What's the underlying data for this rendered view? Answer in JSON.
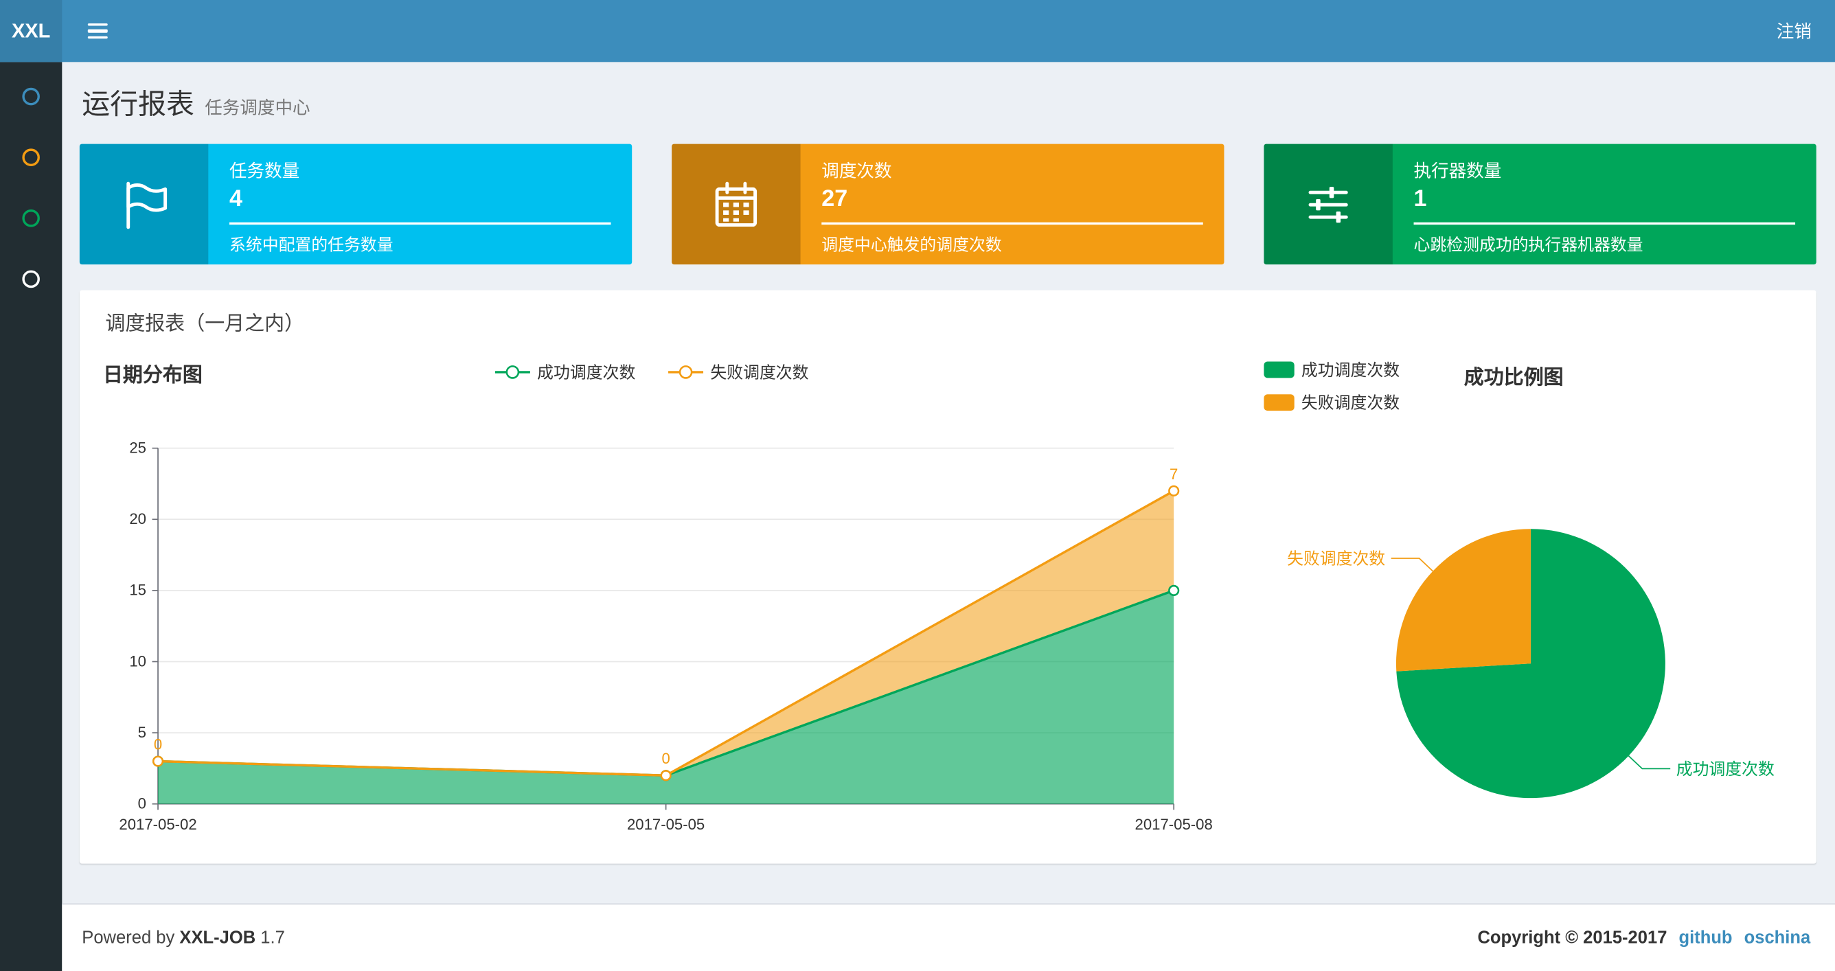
{
  "navbar": {
    "logo": "XXL",
    "logout_label": "注销"
  },
  "sidebar": {
    "items": [
      {
        "icon": "circle-o-icon",
        "color": "#3c8dbc"
      },
      {
        "icon": "circle-o-icon",
        "color": "#f39c12"
      },
      {
        "icon": "circle-o-icon",
        "color": "#00a65a"
      },
      {
        "icon": "circle-o-icon",
        "color": "#ffffff"
      }
    ]
  },
  "header": {
    "title": "运行报表",
    "subtitle": "任务调度中心"
  },
  "info_boxes": [
    {
      "title": "任务数量",
      "value": "4",
      "desc": "系统中配置的任务数量",
      "color": "#00c0ef",
      "icon": "flag-icon"
    },
    {
      "title": "调度次数",
      "value": "27",
      "desc": "调度中心触发的调度次数",
      "color": "#f39c12",
      "icon": "calendar-icon"
    },
    {
      "title": "执行器数量",
      "value": "1",
      "desc": "心跳检测成功的执行器机器数量",
      "color": "#00a65a",
      "icon": "sliders-icon"
    }
  ],
  "panel": {
    "title": "调度报表（一月之内）"
  },
  "chart_data": [
    {
      "type": "area",
      "title": "日期分布图",
      "stacked": true,
      "categories": [
        "2017-05-02",
        "2017-05-05",
        "2017-05-08"
      ],
      "series": [
        {
          "name": "成功调度次数",
          "values": [
            3,
            2,
            15
          ],
          "color": "#00a65a",
          "fill": "rgba(0,166,90,0.62)"
        },
        {
          "name": "失败调度次数",
          "values": [
            0,
            0,
            7
          ],
          "color": "#f39c12",
          "fill": "rgba(243,156,18,0.55)",
          "labels": [
            "0",
            "0",
            "7"
          ]
        }
      ],
      "ylim": [
        0,
        25
      ],
      "yticks": [
        0,
        5,
        10,
        15,
        20,
        25
      ],
      "legend_position": "top",
      "grid": true
    },
    {
      "type": "pie",
      "title": "成功比例图",
      "slices": [
        {
          "name": "成功调度次数",
          "value": 20,
          "color": "#00a65a"
        },
        {
          "name": "失败调度次数",
          "value": 7,
          "color": "#f39c12"
        }
      ],
      "legend_position": "top-left"
    }
  ],
  "footer": {
    "powered_prefix": "Powered by",
    "brand": "XXL-JOB",
    "version": "1.7",
    "copyright": "Copyright © 2015-2017",
    "links": [
      {
        "label": "github"
      },
      {
        "label": "oschina"
      }
    ]
  }
}
